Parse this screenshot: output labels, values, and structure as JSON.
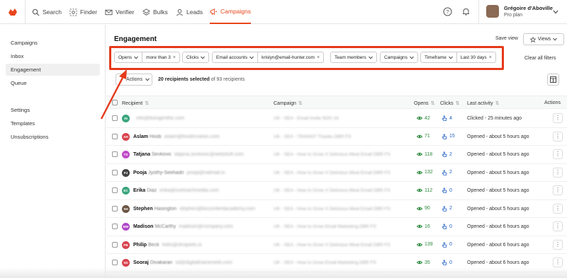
{
  "nav": {
    "items": [
      {
        "label": "Search",
        "icon": "search-icon"
      },
      {
        "label": "Finder",
        "icon": "finder-icon"
      },
      {
        "label": "Verifier",
        "icon": "envelope-check-icon"
      },
      {
        "label": "Bulks",
        "icon": "layers-icon"
      },
      {
        "label": "Leads",
        "icon": "user-icon"
      },
      {
        "label": "Campaigns",
        "icon": "megaphone-icon",
        "active": true
      }
    ],
    "help_icon": "question-circle-icon",
    "bell_icon": "bell-icon"
  },
  "user": {
    "name": "Grégoire d'Aboville",
    "plan": "Pro plan"
  },
  "sidebar": {
    "items": [
      {
        "label": "Campaigns"
      },
      {
        "label": "Inbox"
      },
      {
        "label": "Engagement",
        "active": true
      },
      {
        "label": "Queue"
      },
      {
        "label": "Settings"
      },
      {
        "label": "Templates"
      },
      {
        "label": "Unsubscriptions"
      }
    ]
  },
  "page": {
    "title": "Engagement",
    "save_view": "Save view",
    "views": "Views",
    "clear_all": "Clear all filters",
    "actions": "Actions",
    "selected_count": "20 recipients selected",
    "selected_total": "of 93 recipients"
  },
  "filters": [
    {
      "label": "Opens",
      "value": "more than 3"
    },
    {
      "label": "Clicks"
    },
    {
      "label": "Email accounts",
      "value": "krislyn@email-hunter.com"
    },
    {
      "label": "Team members"
    },
    {
      "label": "Campaigns"
    },
    {
      "label": "Timeframe",
      "value": "Last 30 days"
    }
  ],
  "table": {
    "headers": {
      "recipient": "Recipient",
      "campaign": "Campaign",
      "opens": "Opens",
      "clicks": "Clicks",
      "last_activity": "Last activity",
      "actions": "Actions"
    },
    "rows": [
      {
        "initials": "IN",
        "color": "#3aa57c",
        "first": "",
        "last": "",
        "email": "info@biongenthe.com",
        "campaign": "UK - SEA - Email Invite NOV 24",
        "opens": "42",
        "clicks": "4",
        "activity": "Clicked - 25 minutes ago"
      },
      {
        "initials": "AH",
        "color": "#d9434e",
        "first": "Aslam",
        "last": "Hoob",
        "email": "aslam@foodreviews.com",
        "campaign": "UK - SEA - TRANSIT Thanks DBR FS",
        "opens": "71",
        "clicks": "15",
        "activity": "Opened - about 5 hours ago"
      },
      {
        "initials": "TS",
        "color": "#c04ac8",
        "first": "Tatjana",
        "last": "Sevkovic",
        "email": "tatjana.sevkovic@webstuff.com",
        "campaign": "UK - SEA - How to Grow X Delicious Meal Email DBR FS",
        "opens": "118",
        "clicks": "2",
        "activity": "Opened - about 5 hours ago"
      },
      {
        "initials": "PJ",
        "color": "#444",
        "first": "Pooja",
        "last": "Jyothy-Seehadri",
        "email": "pooja@natmail.in",
        "campaign": "UK - SEA - How to Grow X Delicious Meal Email DBR FS",
        "opens": "132",
        "clicks": "2",
        "activity": "Opened - about 5 hours ago"
      },
      {
        "initials": "EC",
        "color": "#3aa57c",
        "first": "Erika",
        "last": "Diaz",
        "email": "erika@outreachmedia.com",
        "campaign": "UK - SEA - How to Grow X Delicious Meal Email DBR FS",
        "opens": "112",
        "clicks": "0",
        "activity": "Opened - about 5 hours ago"
      },
      {
        "initials": "SH",
        "color": "#6b5443",
        "first": "Stephen",
        "last": "Hasington",
        "email": "stephen@bizcontentacademy.com",
        "campaign": "UK - SEA - How to Grow X Delicious Meal Email DBR FS",
        "opens": "90",
        "clicks": "2",
        "activity": "Opened - about 5 hours ago"
      },
      {
        "initials": "MM",
        "color": "#b047c9",
        "first": "Madison",
        "last": "McCarthy",
        "email": "madison@company.com",
        "campaign": "UK - SEA - How to Grow Email Marketing DBR FS",
        "opens": "16",
        "clicks": "0",
        "activity": "Opened - about 6 hours ago"
      },
      {
        "initials": "PB",
        "color": "#d9434e",
        "first": "Philip",
        "last": "Beck",
        "email": "hello@stropeek.io",
        "campaign": "UK - SEA - How to Grow X Delicious Meal Email DBR FS",
        "opens": "139",
        "clicks": "0",
        "activity": "Opened - about 6 hours ago"
      },
      {
        "initials": "SD",
        "color": "#d9434e",
        "first": "Sooraj",
        "last": "Divakaran",
        "email": "sd@digitaltrainerweb.com",
        "campaign": "UK - SEA - How to Grow Email Marketing DBR FS",
        "opens": "35",
        "clicks": "0",
        "activity": "Opened - about 6 hours ago"
      }
    ]
  },
  "colors": {
    "accent": "#e8461c",
    "highlight": "#e5391a",
    "opens": "#2c8a3e",
    "clicks": "#1f5fc2"
  }
}
